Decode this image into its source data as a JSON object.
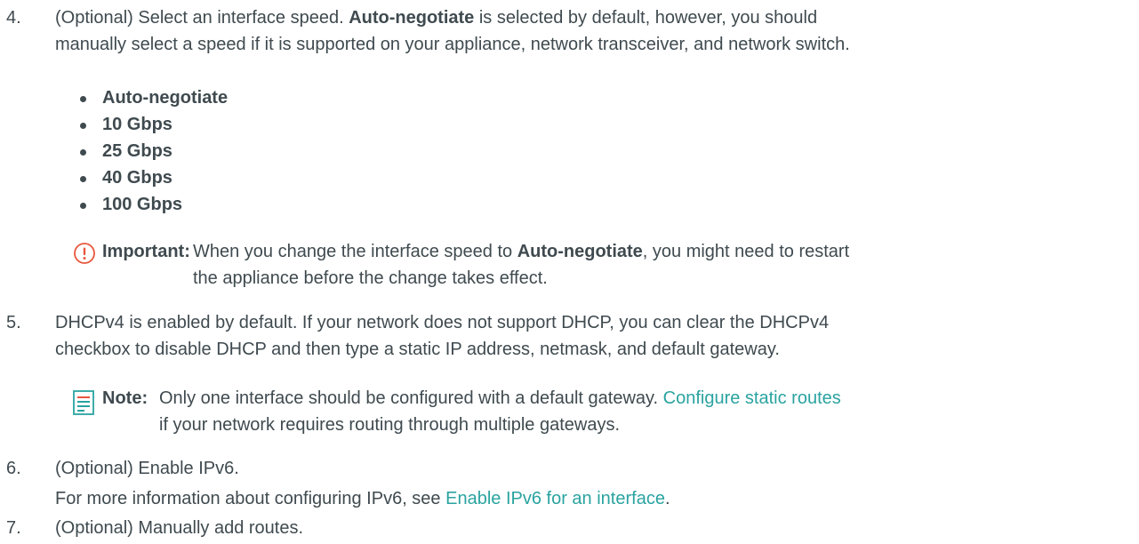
{
  "steps": [
    {
      "number": "4.",
      "line1_a": "(Optional) Select an interface speed. ",
      "line1_b": "Auto-negotiate",
      "line1_c": " is selected by default, however, you should",
      "line2": "manually select a speed if it is supported on your appliance, network transceiver, and network switch.",
      "options": [
        "Auto-negotiate",
        "10 Gbps",
        "25 Gbps",
        "40 Gbps",
        "100 Gbps"
      ],
      "important": {
        "label": "Important:",
        "line1_a": "When you change the interface speed to ",
        "line1_b": "Auto-negotiate",
        "line1_c": ", you might need to restart",
        "line2": "the appliance before the change takes effect."
      }
    },
    {
      "number": "5.",
      "line1": "DHCPv4 is enabled by default. If your network does not support DHCP, you can clear the DHCPv4",
      "line2": "checkbox to disable DHCP and then type a static IP address, netmask, and default gateway.",
      "note": {
        "label": "Note:",
        "line1": "Only one interface should be configured with a default gateway. ",
        "link": "Configure static routes",
        "line2": "if your network requires routing through multiple gateways."
      }
    },
    {
      "number": "6.",
      "line1": "(Optional) Enable IPv6.",
      "line2_a": "For more information about configuring IPv6, see ",
      "link": "Enable IPv6 for an interface",
      "line2_b": "."
    },
    {
      "number": "7.",
      "line1": "(Optional) Manually add routes."
    }
  ],
  "colors": {
    "text": "#3f4a4f",
    "link": "#2aa3a0",
    "important_icon": "#e8563d",
    "note_icon": "#2aa3a0"
  }
}
